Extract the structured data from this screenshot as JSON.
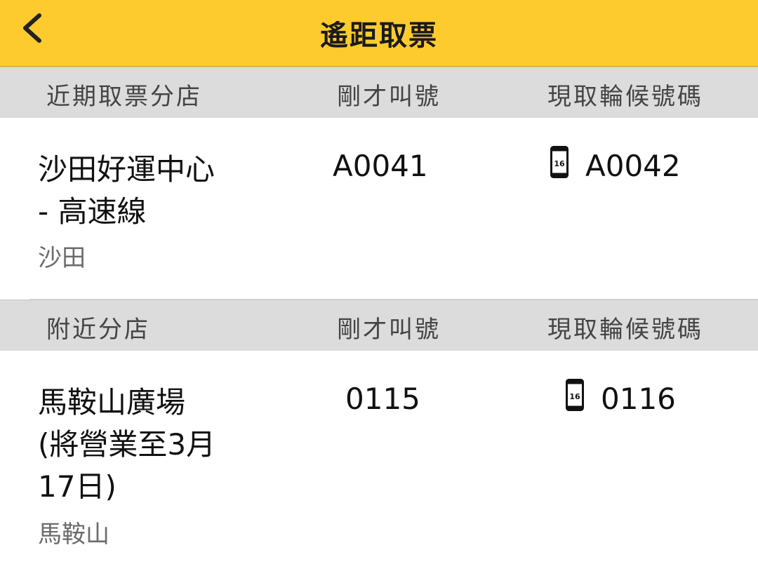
{
  "header": {
    "title": "遙距取票"
  },
  "recent_section": {
    "headers": [
      "近期取票分店",
      "剛才叫號",
      "現取輪候號碼"
    ],
    "rows": [
      {
        "store": "沙田好運中心\n- 高速線",
        "district": "沙田",
        "called": "A0041",
        "current": "A0042",
        "icon_number": "16"
      }
    ]
  },
  "nearby_section": {
    "headers": [
      "附近分店",
      "剛才叫號",
      "現取輪候號碼"
    ],
    "rows": [
      {
        "store": "馬鞍山廣場\n(將營業至3月\n17日)",
        "district": "馬鞍山",
        "called": "0115",
        "current": "0116",
        "icon_number": "16"
      }
    ]
  },
  "icons": {
    "back": "chevron-left-icon",
    "ticket": "phone-ticket-icon"
  },
  "colors": {
    "accent": "#FECB2F",
    "section_bg": "#DCDCDC"
  }
}
